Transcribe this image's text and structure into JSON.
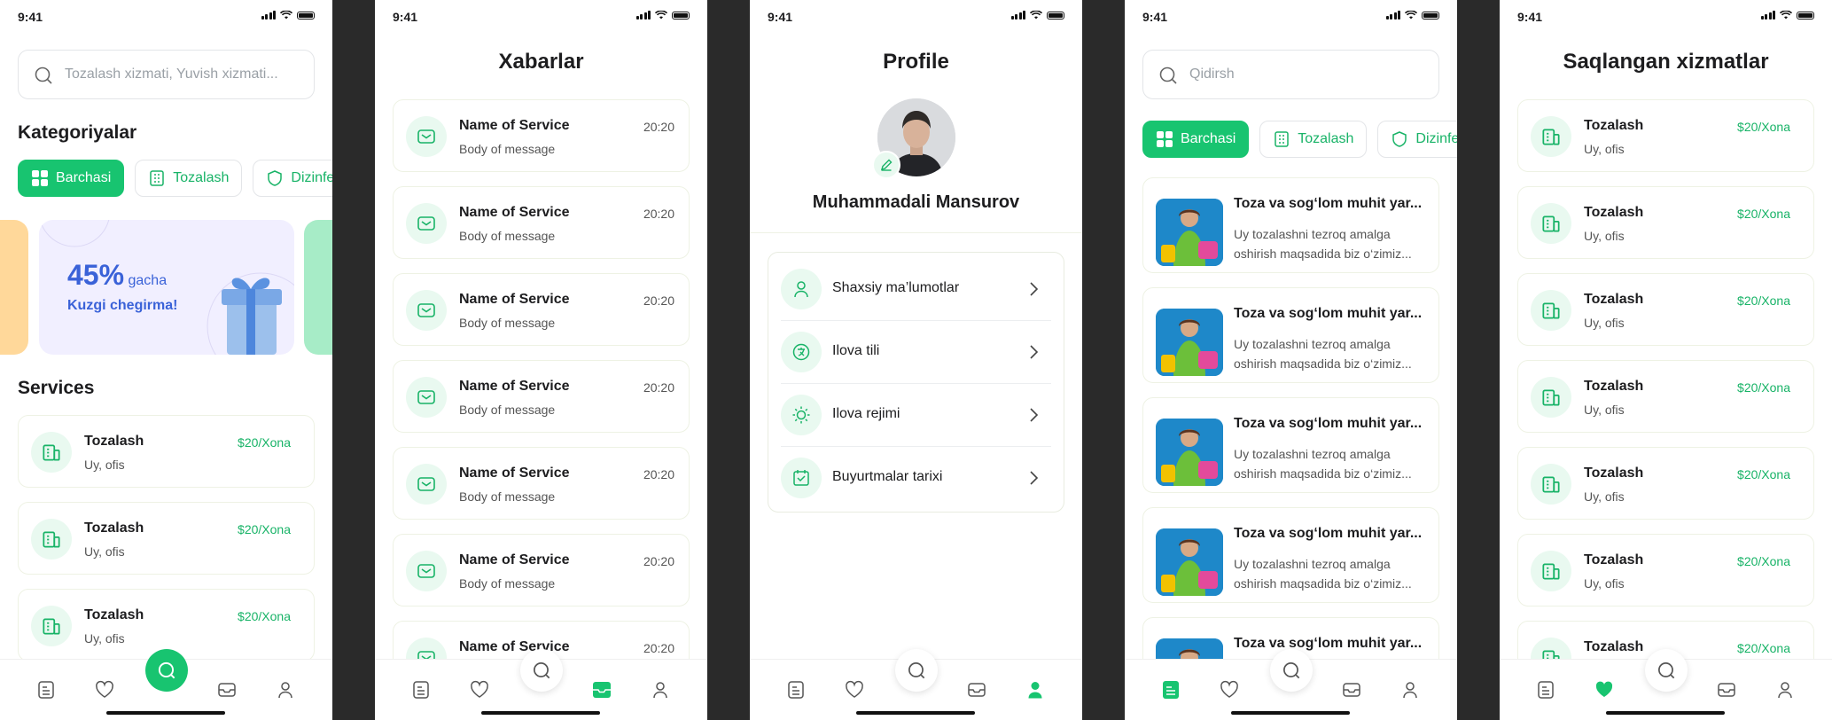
{
  "status": {
    "time": "9:41"
  },
  "colors": {
    "accent": "#18c470",
    "accent_text": "#18b367",
    "icon_bg": "#e9f9f0",
    "promo_bg": "#f1efff",
    "promo_text": "#3a62d8"
  },
  "home": {
    "search_placeholder": "Tozalash xizmati, Yuvish xizmati...",
    "categories_title": "Kategoriyalar",
    "chips": [
      {
        "label": "Barchasi",
        "icon": "grid-icon",
        "active": true
      },
      {
        "label": "Tozalash",
        "icon": "building-icon",
        "active": false
      },
      {
        "label": "Dizinfe",
        "icon": "shield-icon",
        "active": false
      }
    ],
    "promo": {
      "percent": "45%",
      "suffix": "gacha",
      "subtitle": "Kuzgi chegirma!"
    },
    "services_title": "Services",
    "services": [
      {
        "name": "Tozalash",
        "sub": "Uy, ofis",
        "price": "$20/Xona"
      },
      {
        "name": "Tozalash",
        "sub": "Uy, ofis",
        "price": "$20/Xona"
      },
      {
        "name": "Tozalash",
        "sub": "Uy, ofis",
        "price": "$20/Xona"
      }
    ]
  },
  "messages": {
    "title": "Xabarlar",
    "items": [
      {
        "name": "Name of Service",
        "time": "20:20",
        "body": "Body of message"
      },
      {
        "name": "Name of Service",
        "time": "20:20",
        "body": "Body of message"
      },
      {
        "name": "Name of Service",
        "time": "20:20",
        "body": "Body of message"
      },
      {
        "name": "Name of Service",
        "time": "20:20",
        "body": "Body of message"
      },
      {
        "name": "Name of Service",
        "time": "20:20",
        "body": "Body of message"
      },
      {
        "name": "Name of Service",
        "time": "20:20",
        "body": "Body of message"
      },
      {
        "name": "Name of Service",
        "time": "20:20",
        "body": ""
      }
    ]
  },
  "profile": {
    "title": "Profile",
    "name": "Muhammadali Mansurov",
    "menu": [
      {
        "label": "Shaxsiy ma’lumotlar",
        "icon": "user-icon"
      },
      {
        "label": "Ilova tili",
        "icon": "language-icon"
      },
      {
        "label": "Ilova rejimi",
        "icon": "sun-icon"
      },
      {
        "label": "Buyurtmalar tarixi",
        "icon": "history-icon"
      }
    ]
  },
  "search_screen": {
    "placeholder": "Qidirsh",
    "chips": [
      {
        "label": "Barchasi",
        "active": true
      },
      {
        "label": "Tozalash",
        "active": false
      },
      {
        "label": "Dizinfe",
        "active": false
      }
    ],
    "results": [
      {
        "title": "Toza va sog‘lom muhit yar...",
        "desc": "Uy tozalashni tezroq amalga oshirish maqsadida biz o‘zimiz..."
      },
      {
        "title": "Toza va sog‘lom muhit yar...",
        "desc": "Uy tozalashni tezroq amalga oshirish maqsadida biz o‘zimiz..."
      },
      {
        "title": "Toza va sog‘lom muhit yar...",
        "desc": "Uy tozalashni tezroq amalga oshirish maqsadida biz o‘zimiz..."
      },
      {
        "title": "Toza va sog‘lom muhit yar...",
        "desc": "Uy tozalashni tezroq amalga oshirish maqsadida biz o‘zimiz..."
      },
      {
        "title": "Toza va sog‘lom muhit yar...",
        "desc": ""
      }
    ]
  },
  "saved": {
    "title": "Saqlangan xizmatlar",
    "items": [
      {
        "name": "Tozalash",
        "sub": "Uy, ofis",
        "price": "$20/Xona"
      },
      {
        "name": "Tozalash",
        "sub": "Uy, ofis",
        "price": "$20/Xona"
      },
      {
        "name": "Tozalash",
        "sub": "Uy, ofis",
        "price": "$20/Xona"
      },
      {
        "name": "Tozalash",
        "sub": "Uy, ofis",
        "price": "$20/Xona"
      },
      {
        "name": "Tozalash",
        "sub": "Uy, ofis",
        "price": "$20/Xona"
      },
      {
        "name": "Tozalash",
        "sub": "Uy, ofis",
        "price": "$20/Xona"
      },
      {
        "name": "Tozalash",
        "sub": "",
        "price": "$20/Xona"
      }
    ]
  }
}
